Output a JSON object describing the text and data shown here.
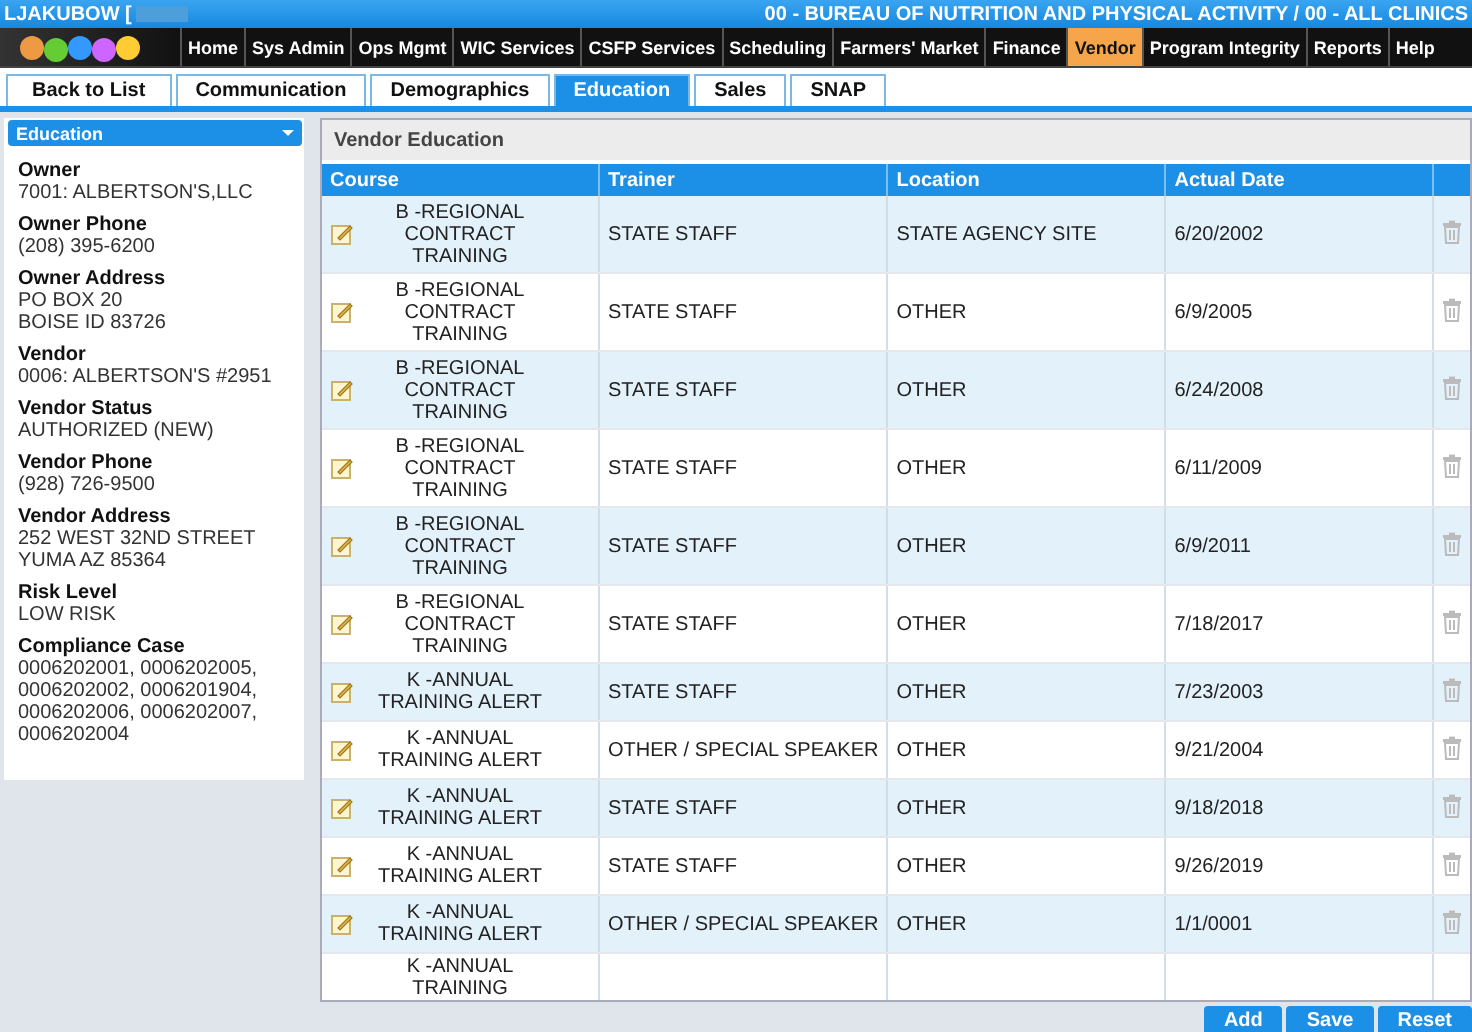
{
  "header": {
    "user": "LJAKUBOW [",
    "agency": "00 - BUREAU OF NUTRITION AND PHYSICAL ACTIVITY / 00 - ALL CLINICS"
  },
  "nav": [
    {
      "label": "Home",
      "selected": false
    },
    {
      "label": "Sys Admin",
      "selected": false
    },
    {
      "label": "Ops Mgmt",
      "selected": false
    },
    {
      "label": "WIC Services",
      "selected": false
    },
    {
      "label": "CSFP Services",
      "selected": false
    },
    {
      "label": "Scheduling",
      "selected": false
    },
    {
      "label": "Farmers' Market",
      "selected": false
    },
    {
      "label": "Finance",
      "selected": false
    },
    {
      "label": "Vendor",
      "selected": true
    },
    {
      "label": "Program Integrity",
      "selected": false
    },
    {
      "label": "Reports",
      "selected": false
    },
    {
      "label": "Help",
      "selected": false
    }
  ],
  "tabs": [
    {
      "label": "Back to List",
      "selected": false
    },
    {
      "label": "Communication",
      "selected": false
    },
    {
      "label": "Demographics",
      "selected": false
    },
    {
      "label": "Education",
      "selected": true
    },
    {
      "label": "Sales",
      "selected": false
    },
    {
      "label": "SNAP",
      "selected": false
    }
  ],
  "sidebar": {
    "dropdown": "Education",
    "fields": [
      {
        "label": "Owner",
        "value": "7001: ALBERTSON'S,LLC"
      },
      {
        "label": "Owner Phone",
        "value": "(208) 395-6200"
      },
      {
        "label": "Owner Address",
        "value": "PO BOX 20\nBOISE ID 83726"
      },
      {
        "label": "Vendor",
        "value": "0006: ALBERTSON'S #2951"
      },
      {
        "label": "Vendor Status",
        "value": "AUTHORIZED (NEW)"
      },
      {
        "label": "Vendor Phone",
        "value": "(928) 726-9500"
      },
      {
        "label": "Vendor Address",
        "value": "252 WEST 32ND STREET\nYUMA AZ 85364"
      },
      {
        "label": "Risk Level",
        "value": "LOW RISK"
      },
      {
        "label": "Compliance Case",
        "value": "0006202001, 0006202005,\n0006202002, 0006201904,\n0006202006, 0006202007,\n0006202004"
      }
    ]
  },
  "panel": {
    "title": "Vendor Education",
    "columns": [
      "Course",
      "Trainer",
      "Location",
      "Actual Date"
    ],
    "rows": [
      {
        "course": "B -REGIONAL CONTRACT TRAINING",
        "trainer": "STATE STAFF",
        "location": "STATE AGENCY SITE",
        "date": "6/20/2002"
      },
      {
        "course": "B -REGIONAL CONTRACT TRAINING",
        "trainer": "STATE STAFF",
        "location": "OTHER",
        "date": "6/9/2005"
      },
      {
        "course": "B -REGIONAL CONTRACT TRAINING",
        "trainer": "STATE STAFF",
        "location": "OTHER",
        "date": "6/24/2008"
      },
      {
        "course": "B -REGIONAL CONTRACT TRAINING",
        "trainer": "STATE STAFF",
        "location": "OTHER",
        "date": "6/11/2009"
      },
      {
        "course": "B -REGIONAL CONTRACT TRAINING",
        "trainer": "STATE STAFF",
        "location": "OTHER",
        "date": "6/9/2011"
      },
      {
        "course": "B -REGIONAL CONTRACT TRAINING",
        "trainer": "STATE STAFF",
        "location": "OTHER",
        "date": "7/18/2017"
      },
      {
        "course": "K -ANNUAL TRAINING ALERT",
        "trainer": "STATE STAFF",
        "location": "OTHER",
        "date": "7/23/2003"
      },
      {
        "course": "K -ANNUAL TRAINING ALERT",
        "trainer": "OTHER / SPECIAL SPEAKER",
        "location": "OTHER",
        "date": "9/21/2004"
      },
      {
        "course": "K -ANNUAL TRAINING ALERT",
        "trainer": "STATE STAFF",
        "location": "OTHER",
        "date": "9/18/2018"
      },
      {
        "course": "K -ANNUAL TRAINING ALERT",
        "trainer": "STATE STAFF",
        "location": "OTHER",
        "date": "9/26/2019"
      },
      {
        "course": "K -ANNUAL TRAINING ALERT",
        "trainer": "OTHER / SPECIAL SPEAKER",
        "location": "OTHER",
        "date": "1/1/0001"
      },
      {
        "course": "K -ANNUAL TRAINING"
      }
    ]
  },
  "buttons": [
    "Add",
    "Save",
    "Reset"
  ]
}
